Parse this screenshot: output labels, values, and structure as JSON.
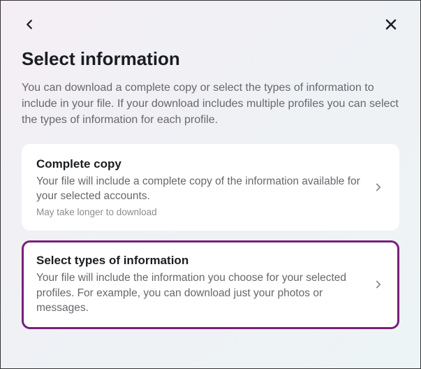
{
  "page": {
    "title": "Select information",
    "description": "You can download a complete copy or select the types of information to include in your file. If your download includes multiple profiles you can select the types of information for each profile."
  },
  "options": [
    {
      "title": "Complete copy",
      "description": "Your file will include a complete copy of the information available for your selected accounts.",
      "note": "May take longer to download",
      "highlighted": false
    },
    {
      "title": "Select types of information",
      "description": "Your file will include the information you choose for your selected profiles. For example, you can download just your photos or messages.",
      "note": "",
      "highlighted": true
    }
  ]
}
